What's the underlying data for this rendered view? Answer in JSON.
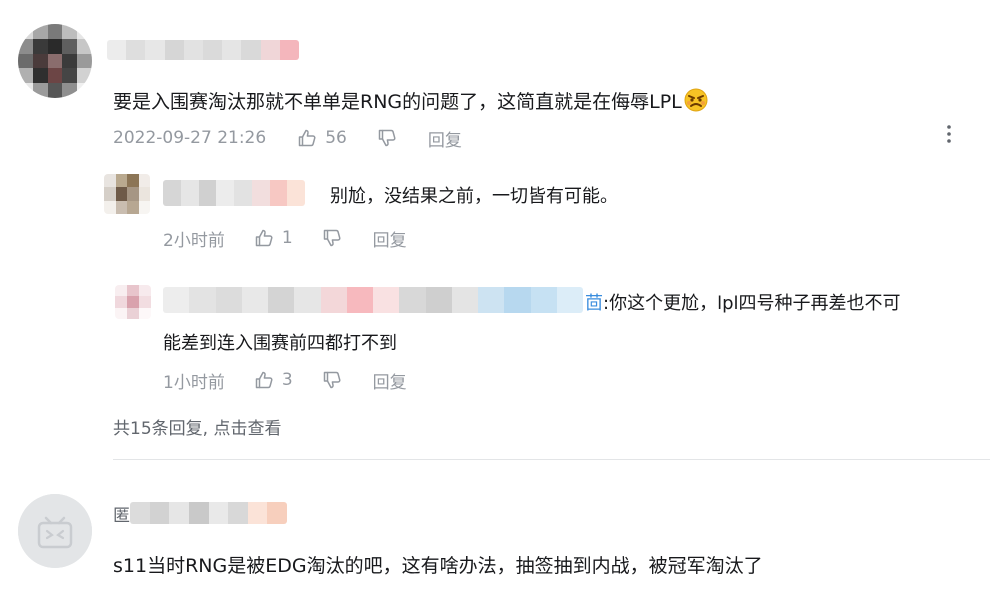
{
  "comment1": {
    "text": "要是入围赛淘汰那就不单单是RNG的问题了，这简直就是在侮辱LPL",
    "emoji_icon": "angry-face-emoji",
    "timestamp": "2022-09-27 21:26",
    "likes": "56",
    "reply_label": "回复",
    "more_icon": "vertical-dots-icon"
  },
  "replies": [
    {
      "text": "别尬，没结果之前，一切皆有可能。",
      "time": "2小时前",
      "likes": "1",
      "reply_label": "回复"
    },
    {
      "mention_tail": "茴",
      "text_line1": ":你这个更尬，lpl四号种子再差也不可",
      "text_line2": "能差到连入围赛前四都打不到",
      "time": "1小时前",
      "likes": "3",
      "reply_label": "回复"
    }
  ],
  "view_more": "共15条回复, 点击查看",
  "comment2": {
    "username_fragment": "匿",
    "text": "s11当时RNG是被EDG淘汰的吧，这有啥办法，抽签抽到内战，被冠军淘汰了"
  },
  "colors": {
    "text": "#18191c",
    "meta": "#9499a0",
    "link": "#3a8dde",
    "divider": "#e3e5e7"
  }
}
